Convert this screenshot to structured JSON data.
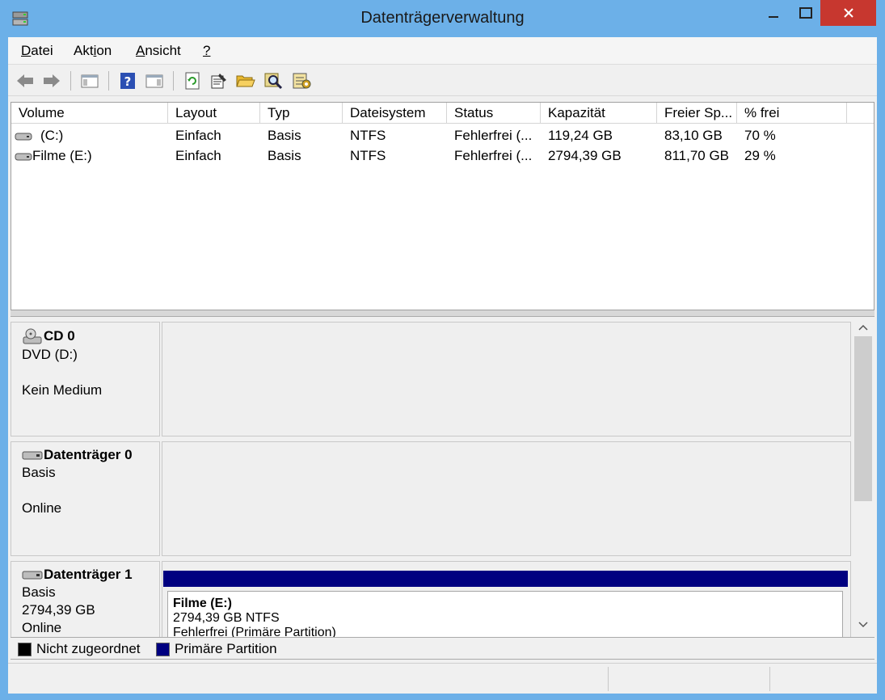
{
  "window": {
    "title": "Datenträgerverwaltung"
  },
  "menu": [
    {
      "label": "Datei"
    },
    {
      "label": "Aktion"
    },
    {
      "label": "Ansicht"
    },
    {
      "label": "?"
    }
  ],
  "volumes": {
    "columns": [
      "Volume",
      "Layout",
      "Typ",
      "Dateisystem",
      "Status",
      "Kapazität",
      "Freier Sp...",
      "% frei"
    ],
    "rows": [
      {
        "volume": "(C:)",
        "layout": "Einfach",
        "typ": "Basis",
        "fs": "NTFS",
        "status": "Fehlerfrei (...",
        "kapazitaet": "119,24 GB",
        "frei": "83,10 GB",
        "prozent": "70 %"
      },
      {
        "volume": "Filme (E:)",
        "layout": "Einfach",
        "typ": "Basis",
        "fs": "NTFS",
        "status": "Fehlerfrei (...",
        "kapazitaet": "2794,39 GB",
        "frei": "811,70 GB",
        "prozent": "29 %"
      }
    ]
  },
  "disks": [
    {
      "name": "CD 0",
      "line1": "DVD (D:)",
      "line2": "Kein Medium"
    },
    {
      "name": "Datenträger 0",
      "line1": "Basis",
      "line2": "Online"
    },
    {
      "name": "Datenträger 1",
      "line1": "Basis",
      "line2": "2794,39 GB",
      "line3": "Online",
      "partition": {
        "name": "Filme  (E:)",
        "size": "2794,39 GB NTFS",
        "status": "Fehlerfrei (Primäre Partition)"
      }
    }
  ],
  "legend": [
    {
      "label": "Nicht zugeordnet",
      "color": "#000000"
    },
    {
      "label": "Primäre Partition",
      "color": "#000080"
    }
  ],
  "colors": {
    "titlebar": "#6cb0e8",
    "close_button": "#c7372f",
    "primary_partition": "#000080"
  }
}
